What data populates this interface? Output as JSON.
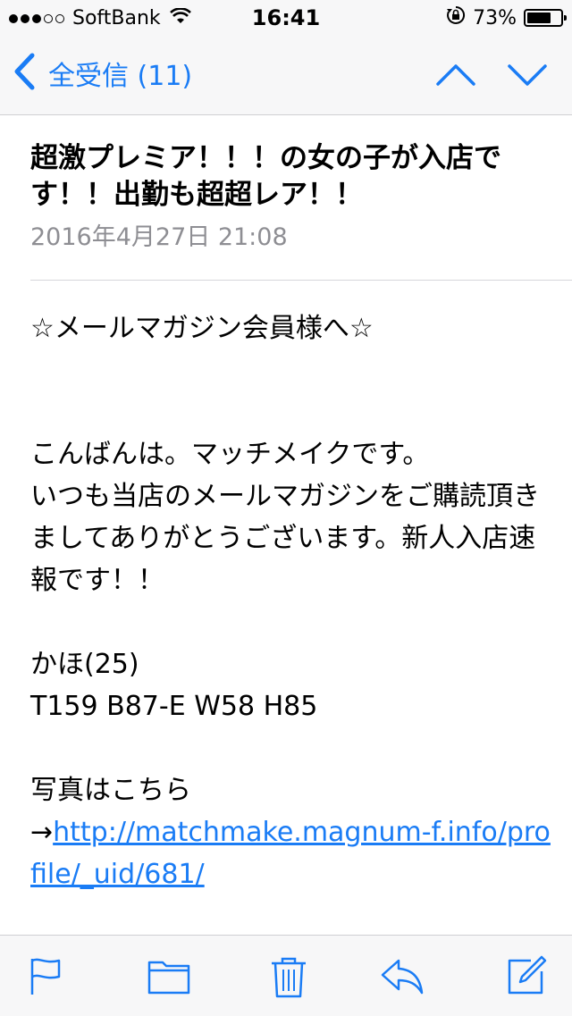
{
  "status_bar": {
    "carrier": "SoftBank",
    "time": "16:41",
    "battery_percent": "73%",
    "battery_level": 0.73,
    "signal_filled": 3,
    "signal_total": 5
  },
  "nav": {
    "back_label": "全受信 (11)",
    "accent_color": "#1a7cf5"
  },
  "message": {
    "subject": "超激プレミア！！！の女の子が入店です！！出勤も超超レア！！",
    "date": "2016年4月27日 21:08",
    "greeting": "☆メールマガジン会員様へ☆",
    "intro": "こんばんは。マッチメイクです。\nいつも当店のメールマガジンをご購読頂きましてありがとうございます。新人入店速報です！！",
    "profile_name": "かほ(25)",
    "profile_stats": "T159 B87-E W58 H85",
    "photo_label": "写真はこちら",
    "arrow": "→",
    "link": "http://matchmake.magnum-f.info/profile/_uid/681/"
  },
  "toolbar": {
    "icons": [
      "flag-icon",
      "folder-icon",
      "trash-icon",
      "reply-icon",
      "compose-icon"
    ]
  }
}
